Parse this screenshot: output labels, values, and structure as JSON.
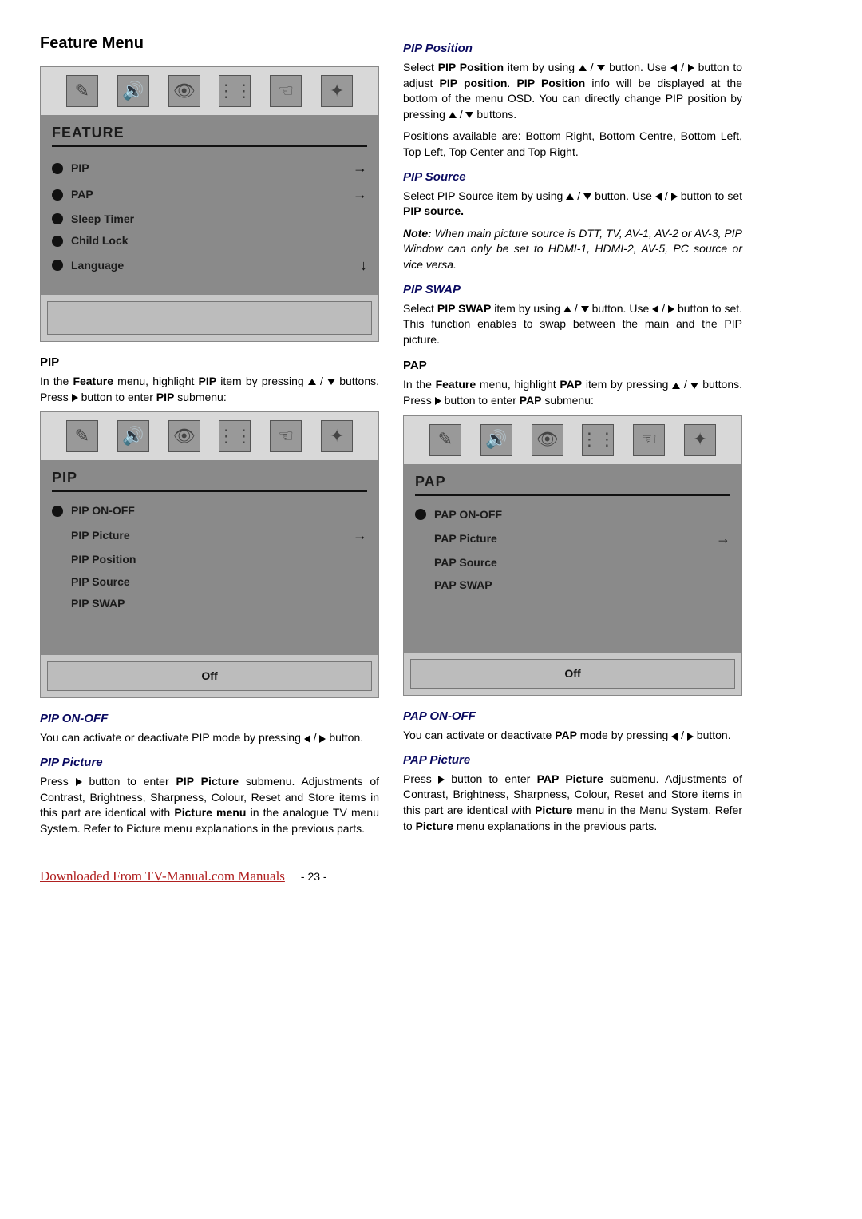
{
  "h1": "Feature Menu",
  "feature_osd": {
    "title": "FEATURE",
    "items": [
      {
        "label": "PIP",
        "arrow": "→"
      },
      {
        "label": "PAP",
        "arrow": "→"
      },
      {
        "label": "Sleep Timer",
        "arrow": ""
      },
      {
        "label": "Child Lock",
        "arrow": ""
      },
      {
        "label": "Language",
        "arrow": "↓"
      }
    ]
  },
  "pip": {
    "heading": "PIP",
    "intro1a": "In the ",
    "intro1b": "Feature",
    "intro1c": " menu, highlight ",
    "intro1d": "PIP",
    "intro1e": " item by pressing ",
    "intro2a": " buttons. Press ",
    "intro2b": " button to enter ",
    "intro2c": "PIP",
    "intro2d": " submenu:"
  },
  "pip_osd": {
    "title": "PIP",
    "items": [
      {
        "label": "PIP ON-OFF",
        "bullet": true,
        "arrow": ""
      },
      {
        "label": "PIP Picture",
        "bullet": false,
        "arrow": "→"
      },
      {
        "label": "PIP Position",
        "bullet": false,
        "arrow": ""
      },
      {
        "label": "PIP Source",
        "bullet": false,
        "arrow": ""
      },
      {
        "label": "PIP SWAP",
        "bullet": false,
        "arrow": ""
      }
    ],
    "footer": "Off"
  },
  "pip_onoff": {
    "heading": "PIP ON-OFF",
    "text1": "You can activate or deactivate PIP mode by pressing ",
    "text2": " button."
  },
  "pip_picture": {
    "heading": "PIP Picture",
    "text1": "Press ",
    "text2": " button to enter ",
    "bold1": "PIP Picture",
    "text3": " submenu. Adjustments of Contrast, Brightness, Sharpness, Colour, Reset and Store items in this part are identical with ",
    "bold2": "Picture menu",
    "text4": " in the analogue TV menu System. Refer to Picture menu explanations in the previous parts."
  },
  "pip_position": {
    "heading": "PIP Position",
    "t1": "Select ",
    "b1": "PIP Position",
    "t2": " item by using ",
    "t3": " button. Use ",
    "t4": " button to adjust ",
    "b2": "PIP position",
    "t5": ". ",
    "b3": "PIP Position",
    "t6": " info will be displayed at the bottom of the menu OSD. You can directly change PIP position by pressing ",
    "t7": " buttons.",
    "p2": "Positions available are: Bottom Right, Bottom Centre, Bottom Left, Top Left, Top Center and Top Right."
  },
  "pip_source": {
    "heading": "PIP Source",
    "t1": "Select PIP Source item by using ",
    "t2": " button. Use ",
    "t3": " button to set ",
    "b1": "PIP source.",
    "note_label": "Note:",
    "note_text": " When main picture source is DTT, TV, AV-1, AV-2 or AV-3, PIP Window can only be set to HDMI-1, HDMI-2, AV-5, PC source or vice versa."
  },
  "pip_swap": {
    "heading": "PIP SWAP",
    "t1": "Select ",
    "b1": "PIP SWAP",
    "t2": " item by using ",
    "t3": " button. Use ",
    "t4": " button to set. This function enables to swap between the main and the PIP picture."
  },
  "pap": {
    "heading": "PAP",
    "t1": "In the ",
    "b1": "Feature",
    "t2": " menu, highlight ",
    "b2": "PAP",
    "t3": " item by pressing ",
    "t4": " buttons. Press ",
    "t5": " button to enter ",
    "b3": "PAP",
    "t6": " submenu:"
  },
  "pap_osd": {
    "title": "PAP",
    "items": [
      {
        "label": "PAP ON-OFF",
        "bullet": true,
        "arrow": ""
      },
      {
        "label": "PAP Picture",
        "bullet": false,
        "arrow": "→"
      },
      {
        "label": "PAP Source",
        "bullet": false,
        "arrow": ""
      },
      {
        "label": "PAP SWAP",
        "bullet": false,
        "arrow": ""
      }
    ],
    "footer": "Off"
  },
  "pap_onoff": {
    "heading": "PAP ON-OFF",
    "t1": "You can activate or deactivate ",
    "b1": "PAP",
    "t2": " mode by pressing ",
    "t3": " button."
  },
  "pap_picture": {
    "heading": "PAP Picture",
    "t1": "Press ",
    "t2": " button to enter ",
    "b1": "PAP Picture",
    "t3": " submenu. Adjustments of Contrast, Brightness, Sharpness, Colour, Reset and Store items in this part are identical with ",
    "b2": "Picture",
    "t4": " menu in the Menu System. Refer to ",
    "b3": "Picture",
    "t5": " menu explanations in the previous parts."
  },
  "footer": {
    "link": "Downloaded From TV-Manual.com Manuals",
    "page": "- 23 -"
  }
}
